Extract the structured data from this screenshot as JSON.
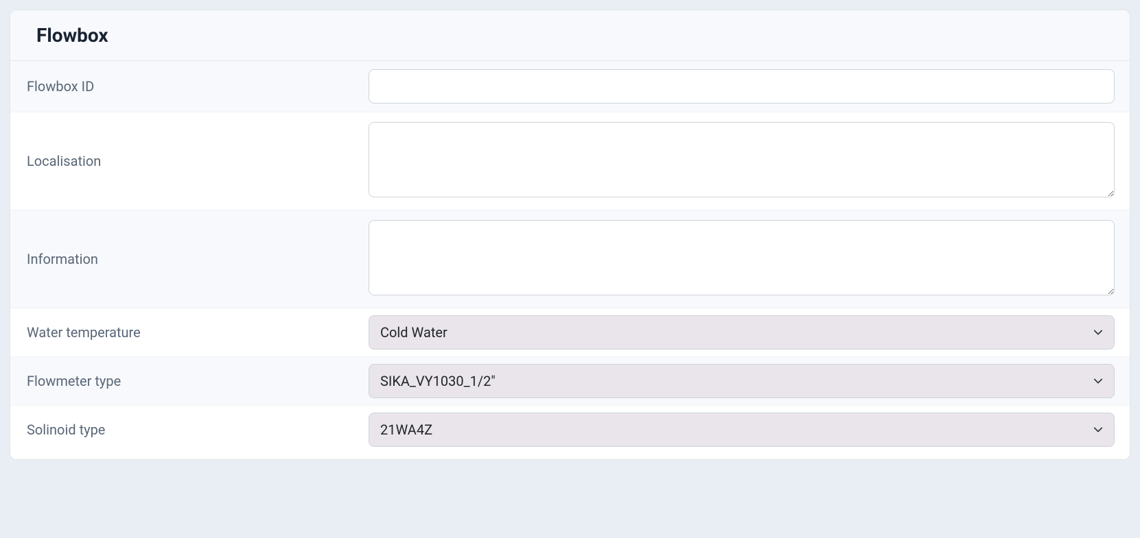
{
  "card": {
    "title": "Flowbox"
  },
  "form": {
    "flowbox_id": {
      "label": "Flowbox ID",
      "value": ""
    },
    "localisation": {
      "label": "Localisation",
      "value": ""
    },
    "information": {
      "label": "Information",
      "value": ""
    },
    "water_temperature": {
      "label": "Water temperature",
      "selected": "Cold Water"
    },
    "flowmeter_type": {
      "label": "Flowmeter type",
      "selected": "SIKA_VY1030_1/2\""
    },
    "solinoid_type": {
      "label": "Solinoid type",
      "selected": "21WA4Z"
    }
  }
}
